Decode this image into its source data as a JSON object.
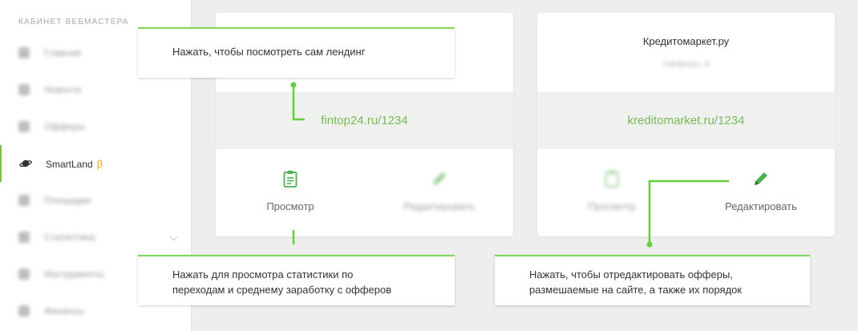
{
  "sidebar": {
    "title": "КАБИНЕТ ВЕБМАСТЕРА",
    "items": [
      {
        "label": "Главная"
      },
      {
        "label": "Новости"
      },
      {
        "label": "Офферы"
      },
      {
        "label": "SmartLand",
        "badge": "β"
      },
      {
        "label": "Площадки"
      },
      {
        "label": "Статистика"
      },
      {
        "label": "Инструменты"
      },
      {
        "label": "Финансы"
      }
    ]
  },
  "cards": [
    {
      "title": "",
      "link": "fintop24.ru/1234",
      "view_label": "Просмотр",
      "edit_label": "Редактировать"
    },
    {
      "title": "Кредитомаркет.ру",
      "subtitle": "Офферы: 9",
      "link": "kreditomarket.ru/1234",
      "view_label": "Просмотр",
      "edit_label": "Редактировать"
    }
  ],
  "callouts": {
    "view_landing": "Нажать, чтобы посмотреть сам лендинг",
    "stats_line1": "Нажать для просмотра статистики по",
    "stats_line2": "переходам и среднему заработку с офферов",
    "edit_line1": "Нажать, чтобы отредактировать офферы,",
    "edit_line2": "размешаемые на сайте, а также их порядок"
  },
  "colors": {
    "accent": "#7ed957",
    "link": "#7ab85a",
    "beta": "#f5a623"
  }
}
